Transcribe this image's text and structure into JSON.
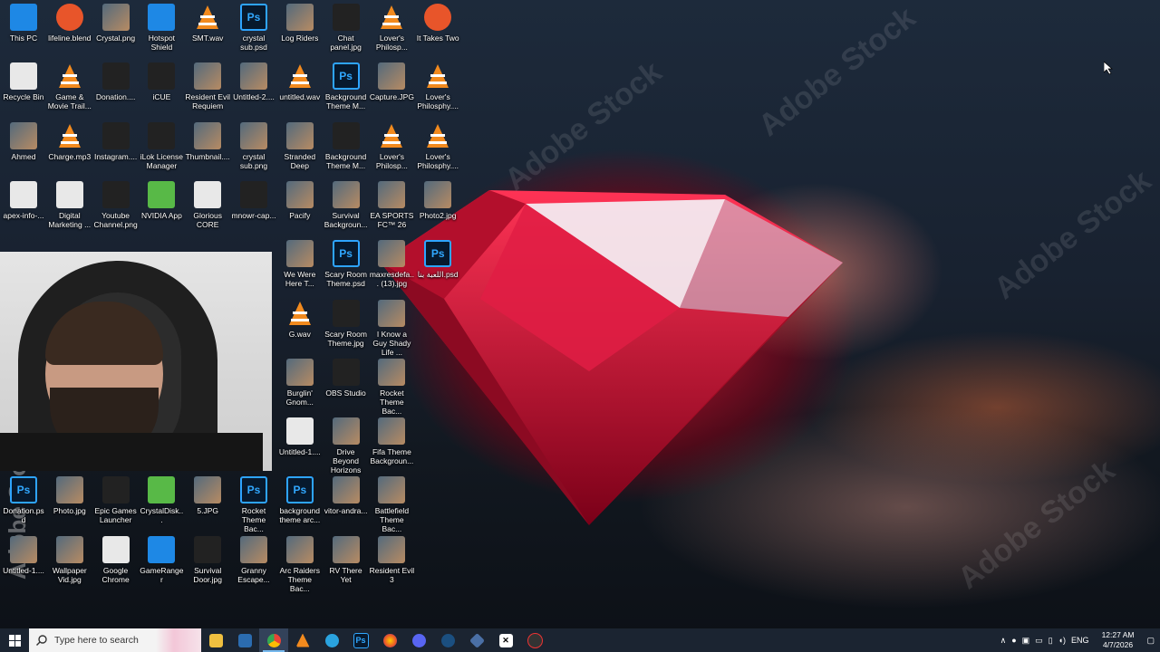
{
  "watermark": "Adobe Stock",
  "desktop_icons": [
    {
      "label": "This PC",
      "kind": "blue"
    },
    {
      "label": "lifeline.blend",
      "kind": "orange"
    },
    {
      "label": "Crystal.png",
      "kind": "img"
    },
    {
      "label": "Hotspot Shield",
      "kind": "blue"
    },
    {
      "label": "SMT.wav",
      "kind": "vlc"
    },
    {
      "label": "crystal sub.psd",
      "kind": "ps"
    },
    {
      "label": "Log Riders",
      "kind": "img"
    },
    {
      "label": "Chat panel.jpg",
      "kind": "dark"
    },
    {
      "label": "Lover's Philosp...",
      "kind": "vlc"
    },
    {
      "label": "It Takes Two",
      "kind": "orange"
    },
    {
      "label": "Recycle Bin",
      "kind": "white"
    },
    {
      "label": "Game & Movie Trail...",
      "kind": "vlc"
    },
    {
      "label": "Donation....",
      "kind": "dark"
    },
    {
      "label": "iCUE",
      "kind": "dark"
    },
    {
      "label": "Resident Evil Requiem",
      "kind": "img"
    },
    {
      "label": "Untitled-2....",
      "kind": "img"
    },
    {
      "label": "untitled.wav",
      "kind": "vlc"
    },
    {
      "label": "Background Theme M...",
      "kind": "ps"
    },
    {
      "label": "Capture.JPG",
      "kind": "img"
    },
    {
      "label": "Lover's Philosphy....",
      "kind": "vlc"
    },
    {
      "label": "Ahmed",
      "kind": "img"
    },
    {
      "label": "Charge.mp3",
      "kind": "vlc"
    },
    {
      "label": "Instagram....",
      "kind": "dark"
    },
    {
      "label": "iLok License Manager",
      "kind": "dark"
    },
    {
      "label": "Thumbnail....",
      "kind": "img"
    },
    {
      "label": "crystal sub.png",
      "kind": "img"
    },
    {
      "label": "Stranded Deep",
      "kind": "img"
    },
    {
      "label": "Background Theme M...",
      "kind": "dark"
    },
    {
      "label": "Lover's Philosp...",
      "kind": "vlc"
    },
    {
      "label": "Lover's Philosphy....",
      "kind": "vlc"
    },
    {
      "label": "apex-info-...",
      "kind": "white"
    },
    {
      "label": "Digital Marketing ...",
      "kind": "white"
    },
    {
      "label": "Youtube Channel.png",
      "kind": "dark"
    },
    {
      "label": "NVIDIA App",
      "kind": "green"
    },
    {
      "label": "Glorious CORE",
      "kind": "white"
    },
    {
      "label": "mnowr-cap...",
      "kind": "dark"
    },
    {
      "label": "Pacify",
      "kind": "img"
    },
    {
      "label": "Survival Backgroun...",
      "kind": "img"
    },
    {
      "label": "EA SPORTS FC™ 26",
      "kind": "img"
    },
    {
      "label": "Photo2.jpg",
      "kind": "img"
    },
    {
      "label": "We Were Here T...",
      "kind": "img"
    },
    {
      "label": "Scary Room Theme.psd",
      "kind": "ps"
    },
    {
      "label": "maxresdefa... (13).jpg",
      "kind": "img"
    },
    {
      "label": "اللعبة بنا.psd",
      "kind": "ps"
    },
    {
      "label": "G.wav",
      "kind": "vlc"
    },
    {
      "label": "Scary Room Theme.jpg",
      "kind": "dark"
    },
    {
      "label": "I Know a Guy Shady Life ...",
      "kind": "img"
    },
    {
      "label": "Burglin' Gnom...",
      "kind": "img"
    },
    {
      "label": "OBS Studio",
      "kind": "dark"
    },
    {
      "label": "Rocket Theme Bac...",
      "kind": "img"
    },
    {
      "label": "Untitled-1....",
      "kind": "white"
    },
    {
      "label": "Drive Beyond Horizons",
      "kind": "img"
    },
    {
      "label": "Fifa Theme Backgroun...",
      "kind": "img"
    },
    {
      "label": "Donation.psd",
      "kind": "ps"
    },
    {
      "label": "Photo.jpg",
      "kind": "img"
    },
    {
      "label": "Epic Games Launcher",
      "kind": "dark"
    },
    {
      "label": "CrystalDisk...",
      "kind": "green"
    },
    {
      "label": "5.JPG",
      "kind": "img"
    },
    {
      "label": "Rocket Theme Bac...",
      "kind": "ps"
    },
    {
      "label": "background theme arc...",
      "kind": "ps"
    },
    {
      "label": "vitor-andra...",
      "kind": "img"
    },
    {
      "label": "Battlefield Theme Bac...",
      "kind": "img"
    },
    {
      "label": "Untitled-1....",
      "kind": "img"
    },
    {
      "label": "Wallpaper Vid.jpg",
      "kind": "img"
    },
    {
      "label": "Google Chrome",
      "kind": "white"
    },
    {
      "label": "GameRanger",
      "kind": "blue"
    },
    {
      "label": "Survival Door.jpg",
      "kind": "dark"
    },
    {
      "label": "Granny Escape...",
      "kind": "img"
    },
    {
      "label": "Arc Raiders Theme Bac...",
      "kind": "img"
    },
    {
      "label": "RV There Yet",
      "kind": "img"
    },
    {
      "label": "Resident Evil 3",
      "kind": "img"
    }
  ],
  "taskbar": {
    "search_placeholder": "Type here to search",
    "apps": [
      "file-explorer",
      "store",
      "chrome",
      "vlc",
      "telegram",
      "photoshop",
      "firefox",
      "discord",
      "steam",
      "app-diamond",
      "capcut",
      "obs"
    ],
    "tray": {
      "lang": "ENG",
      "time": "12:27 AM",
      "date": "4/7/2026"
    }
  }
}
